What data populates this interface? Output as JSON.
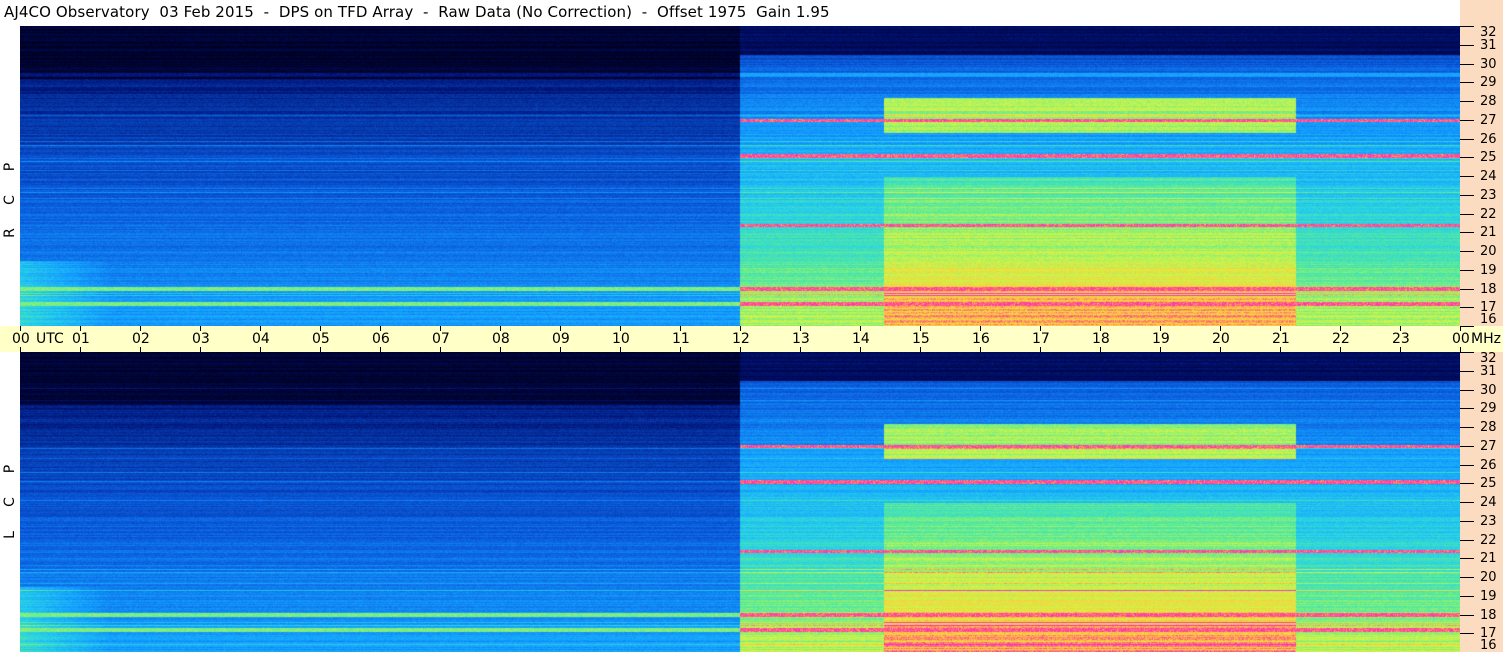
{
  "title": "AJ4CO Observatory  03 Feb 2015  -  DPS on TFD Array  -  Raw Data (No Correction)  -  Offset 1975  Gain 1.95",
  "channels": {
    "top": [
      "R",
      "C",
      "P"
    ],
    "bottom": [
      "L",
      "C",
      "P"
    ]
  },
  "time_axis": {
    "labels": [
      "00",
      "01",
      "02",
      "03",
      "04",
      "05",
      "06",
      "07",
      "08",
      "09",
      "10",
      "11",
      "12",
      "13",
      "14",
      "15",
      "16",
      "17",
      "18",
      "19",
      "20",
      "21",
      "22",
      "23",
      "00"
    ],
    "utc_label": "UTC",
    "mhz_label": "MHz"
  },
  "freq_axis": {
    "labels": [
      "32",
      "31",
      "30",
      "29",
      "28",
      "27",
      "26",
      "25",
      "24",
      "23",
      "22",
      "21",
      "20",
      "19",
      "18",
      "17",
      "16"
    ]
  },
  "colors": {
    "axis_band": "#ffffc8",
    "freq_band": "#fcdcc0",
    "colormap_low": "#00002a",
    "colormap_mid": "#1a8cff",
    "colormap_high": "#ffff40",
    "colormap_peak": "#ff33cc"
  },
  "chart_data": {
    "type": "heatmap",
    "title": "AJ4CO Observatory  03 Feb 2015  -  DPS on TFD Array  -  Raw Data (No Correction)  -  Offset 1975  Gain 1.95",
    "xlabel": "UTC",
    "ylabel": "MHz",
    "x_range_hours_utc": [
      0,
      24
    ],
    "y_range_mhz": [
      16,
      32
    ],
    "panels": [
      {
        "name": "RCP",
        "letters": [
          "R",
          "C",
          "P"
        ]
      },
      {
        "name": "LCP",
        "letters": [
          "L",
          "C",
          "P"
        ]
      }
    ],
    "day_activity_start_utc": 12.0,
    "enhanced_band_utc": [
      14.4,
      21.25
    ],
    "strong_bands_mhz": [
      17.2,
      18.0,
      21.4,
      25.1,
      27.0
    ],
    "grid": false
  }
}
